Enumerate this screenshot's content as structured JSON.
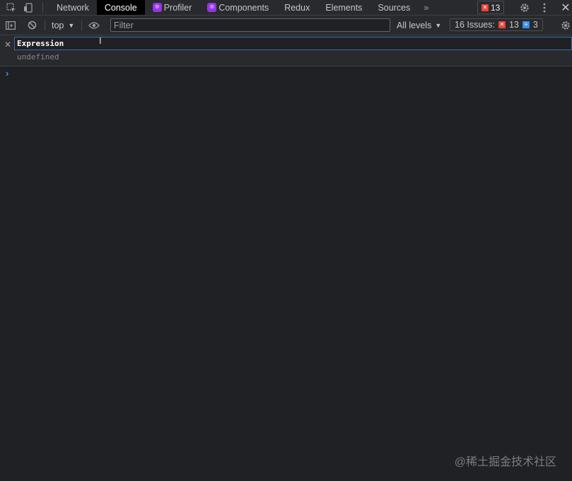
{
  "tabs": [
    {
      "label": "Network",
      "react": false,
      "active": false
    },
    {
      "label": "Console",
      "react": false,
      "active": true
    },
    {
      "label": "Profiler",
      "react": true,
      "active": false
    },
    {
      "label": "Components",
      "react": true,
      "active": false
    },
    {
      "label": "Redux",
      "react": false,
      "active": false
    },
    {
      "label": "Elements",
      "react": false,
      "active": false
    },
    {
      "label": "Sources",
      "react": false,
      "active": false
    }
  ],
  "error_count": "13",
  "toolbar": {
    "context": "top",
    "filter_placeholder": "Filter",
    "levels": "All levels",
    "issues_label": "16 Issues:",
    "issues_errors": "13",
    "issues_info": "3"
  },
  "live_expression": {
    "input": "Expression",
    "result": "undefined"
  },
  "watermark": "@稀土掘金技术社区",
  "colors": {
    "background": "#202124",
    "toolbar": "#292a2d",
    "accent": "#3b6ea5",
    "error": "#e8453c",
    "info": "#3b8ff0",
    "react": "#9334e6"
  }
}
